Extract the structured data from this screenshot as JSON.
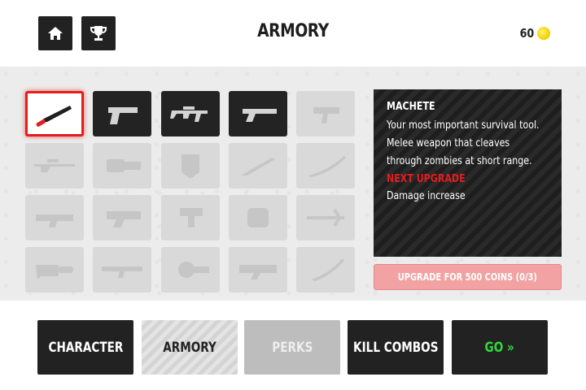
{
  "header": {
    "title": "ARMORY",
    "coins": "60"
  },
  "weapons": [
    {
      "name": "machete",
      "state": "selected",
      "icon": "machete-icon"
    },
    {
      "name": "pistol",
      "state": "owned",
      "icon": "pistol-icon"
    },
    {
      "name": "assault-rifle",
      "state": "owned",
      "icon": "assault-rifle-icon"
    },
    {
      "name": "shotgun",
      "state": "owned",
      "icon": "shotgun-icon"
    },
    {
      "name": "smg",
      "state": "locked",
      "icon": "smg-icon"
    },
    {
      "name": "sniper-rifle",
      "state": "locked",
      "icon": "sniper-rifle-icon"
    },
    {
      "name": "minigun",
      "state": "locked",
      "icon": "minigun-icon"
    },
    {
      "name": "riot-shield",
      "state": "locked",
      "icon": "riot-shield-icon"
    },
    {
      "name": "knife",
      "state": "locked",
      "icon": "knife-icon"
    },
    {
      "name": "katana",
      "state": "locked",
      "icon": "katana-icon"
    },
    {
      "name": "rocket-rifle",
      "state": "locked",
      "icon": "rocket-rifle-icon"
    },
    {
      "name": "plasma-gun",
      "state": "locked",
      "icon": "plasma-gun-icon"
    },
    {
      "name": "nail-gun",
      "state": "locked",
      "icon": "nail-gun-icon"
    },
    {
      "name": "gauntlet",
      "state": "locked",
      "icon": "gauntlet-icon"
    },
    {
      "name": "crossbow",
      "state": "locked",
      "icon": "crossbow-icon"
    },
    {
      "name": "chainsaw",
      "state": "locked",
      "icon": "chainsaw-icon"
    },
    {
      "name": "rocket-launcher",
      "state": "locked",
      "icon": "rocket-launcher-icon"
    },
    {
      "name": "grenade-launcher",
      "state": "locked",
      "icon": "grenade-launcher-icon"
    },
    {
      "name": "laser-rifle",
      "state": "locked",
      "icon": "laser-rifle-icon"
    },
    {
      "name": "sword",
      "state": "locked",
      "icon": "sword-icon"
    }
  ],
  "info": {
    "name": "MACHETE",
    "description": "Your most important survival tool. Melee weapon that cleaves through zombies at short range.",
    "upgrade_title": "NEXT UPGRADE",
    "upgrade_description": "Damage increase",
    "upgrade_button": "UPGRADE FOR 500 COINS (0/3)"
  },
  "nav": {
    "character": "CHARACTER",
    "armory": "ARMORY",
    "perks": "PERKS",
    "kill_combos": "KILL COMBOS",
    "go": "GO »"
  },
  "colors": {
    "accent_red": "#e31e1e",
    "go_green": "#2fd839",
    "coin_yellow": "#f5d400"
  }
}
